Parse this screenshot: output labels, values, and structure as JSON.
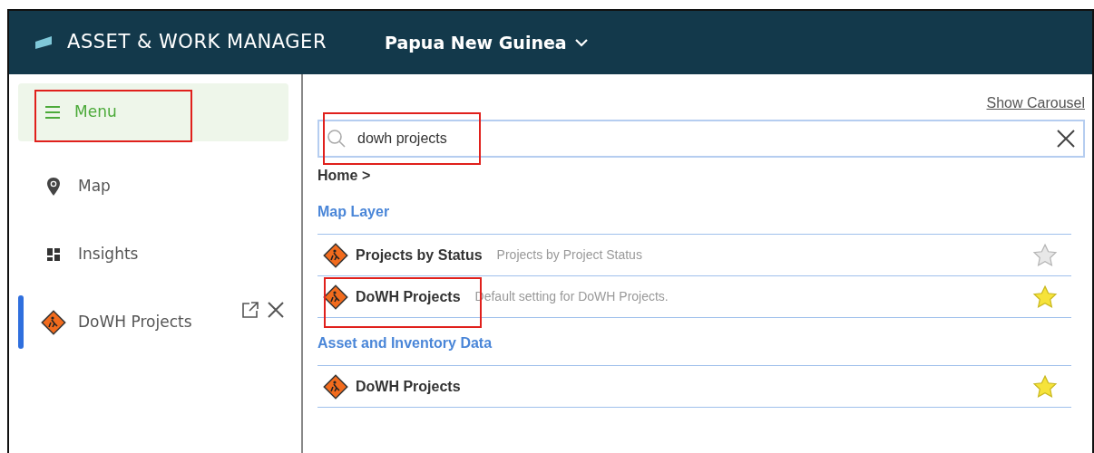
{
  "header": {
    "app_title": "ASSET & WORK MANAGER",
    "region": "Papua New Guinea"
  },
  "sidebar": {
    "menu": {
      "label": "Menu",
      "active": true,
      "annotated": true
    },
    "items": [
      {
        "kind": "map",
        "label": "Map",
        "selected": false
      },
      {
        "kind": "insights",
        "label": "Insights",
        "selected": false
      },
      {
        "kind": "project",
        "label": "DoWH Projects",
        "selected": true,
        "closable": true
      }
    ]
  },
  "content": {
    "show_carousel": "Show Carousel",
    "search": {
      "value": "dowh projects",
      "annotated": true
    },
    "breadcrumb": "Home >",
    "sections": [
      {
        "title": "Map Layer",
        "results": [
          {
            "name": "Projects by Status",
            "description": "Projects by Project Status",
            "favorite": false,
            "annotated": false
          },
          {
            "name": "DoWH Projects",
            "description": "Default setting for DoWH Projects.",
            "favorite": true,
            "annotated": true
          }
        ]
      },
      {
        "title": "Asset and Inventory Data",
        "results": [
          {
            "name": "DoWH Projects",
            "favorite": true,
            "annotated": false
          }
        ]
      }
    ]
  }
}
